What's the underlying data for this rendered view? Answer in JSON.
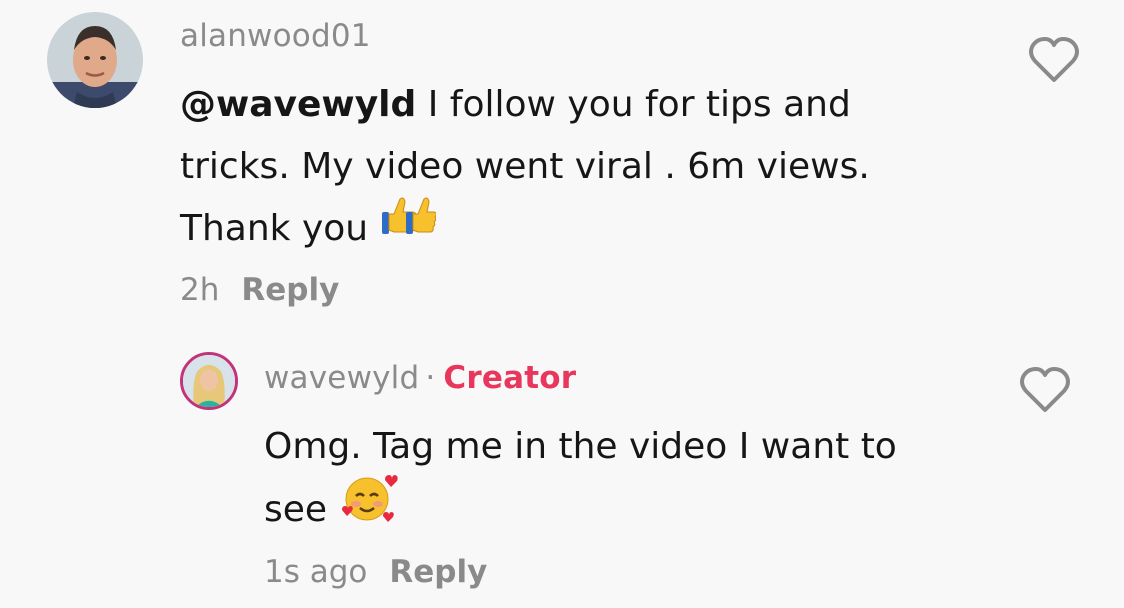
{
  "comments": [
    {
      "username": "alanwood01",
      "mention": "@wavewyld",
      "text_line1_rest": " I follow you for tips and",
      "text_line2": "tricks. My video went viral . 6m views.",
      "text_line3": "Thank you ",
      "time": "2h",
      "reply_label": "Reply",
      "emojis": [
        "thumbs-up-emoji",
        "thumbs-up-emoji"
      ],
      "like_icon": "heart-outline-icon"
    },
    {
      "username": "wavewyld",
      "separator": "·",
      "badge": "Creator",
      "text_line1": "Omg. Tag me in the video I want to",
      "text_line2": "see ",
      "time": "1s ago",
      "reply_label": "Reply",
      "emojis": [
        "smiling-face-with-hearts-emoji"
      ],
      "like_icon": "heart-outline-icon"
    }
  ],
  "colors": {
    "background": "#f8f8f8",
    "text": "#161616",
    "muted": "#8a8a8a",
    "creator_badge": "#e8365d"
  }
}
